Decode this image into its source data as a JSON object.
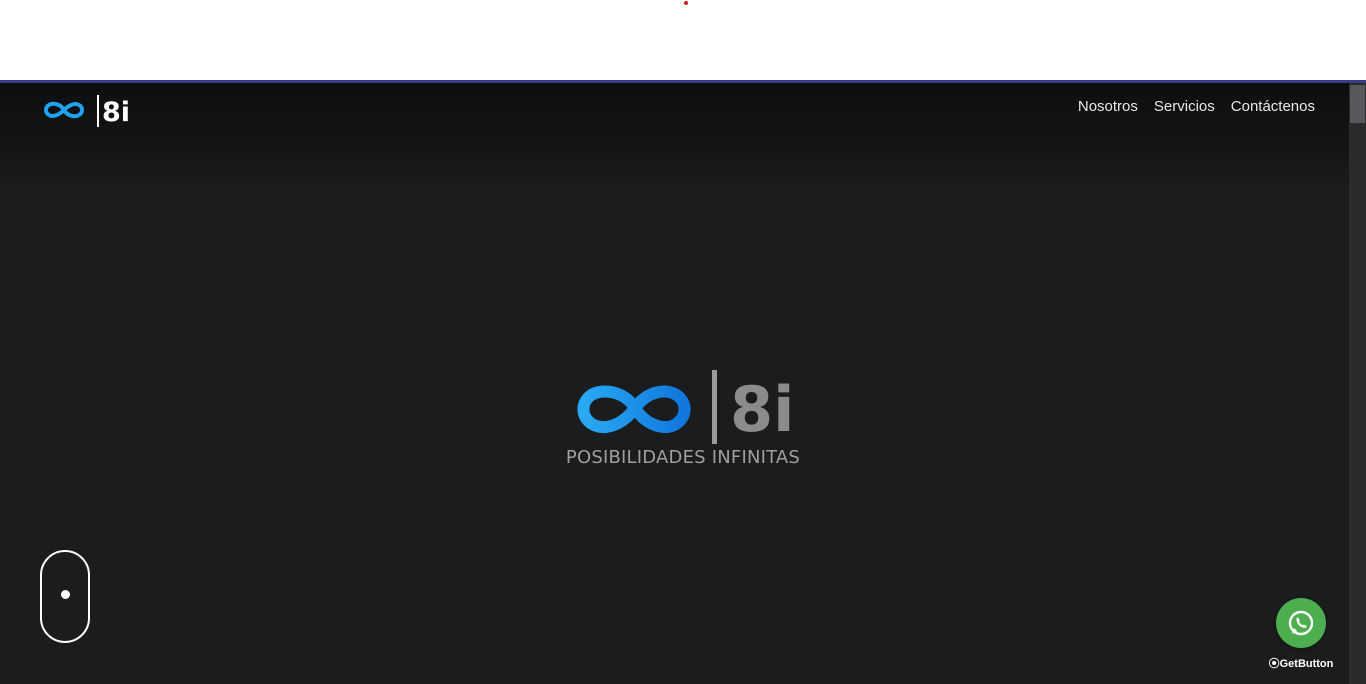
{
  "brand": {
    "logo_text": "8i",
    "tagline": "POSIBILIDADES INFINITAS",
    "accent_color": "#1fa3ef",
    "logo_grey": "#8b8b8b"
  },
  "nav": {
    "items": [
      {
        "label": "Nosotros"
      },
      {
        "label": "Servicios"
      },
      {
        "label": "Contáctenos"
      }
    ]
  },
  "widgets": {
    "getbutton_label": "GetButton",
    "whatsapp_icon": "whatsapp-icon",
    "whatsapp_color": "#4cae4f"
  },
  "hero": {
    "scroll_hint_icon": "mouse-scroll-icon"
  }
}
